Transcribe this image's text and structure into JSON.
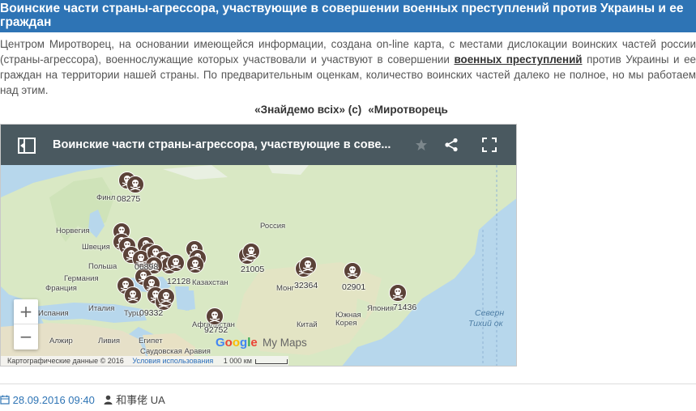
{
  "article": {
    "title": "Воинские части страны-агрессора, участвующие в совершении военных преступлений против Украины и ее граждан",
    "intro_before_link": "Центром Миротворец, на основании имеющейся информации, создана on-line карта, с местами дислокации воинских частей россии (страны-агрессора), военнослужащие которых участвовали и участвуют в совершении ",
    "intro_link": "военных преступлений",
    "intro_after_link": " против Украины и ее граждан на территории нашей страны. По предварительным оценкам,  количество воинских частей далеко не полное, но мы работаем над этим.",
    "slogan_part1": "«Знайдемо всіх» (с)",
    "slogan_part2": "«Миротворець"
  },
  "map": {
    "header_title": "Воинские части страны-агрессора, участвующие в сове...",
    "icons": {
      "sidebar": "sidebar-toggle-icon",
      "star": "star-icon",
      "share": "share-icon",
      "fullscreen": "fullscreen-icon"
    },
    "marker_labels": [
      "08275",
      "06898",
      "12128",
      "21005",
      "32364",
      "02901",
      "71436",
      "09332",
      "92752"
    ],
    "place_labels": {
      "finland": "Финл",
      "norway": "Норвегия",
      "sweden": "Швеция",
      "poland": "Польша",
      "germany": "Германия",
      "france": "Франция",
      "spain": "Испания",
      "italy": "Италия",
      "turkey": "Турц",
      "algeria": "Алжир",
      "libya": "Ливия",
      "egypt": "Египет",
      "saudi": "Саудовская Аравия",
      "russia": "Россия",
      "kazakhstan": "Казахстан",
      "mongolia": "Монг",
      "china": "Китай",
      "afghanistan": "Афганистан",
      "s_korea": "Южная Корея",
      "japan": "Япония",
      "n_pacific": "Северн",
      "pacific": "Тихий ок"
    },
    "zoom_in": "+",
    "zoom_out": "−",
    "google_logo": "Google",
    "mymaps": "My Maps",
    "attribution": "Картографические данные © 2016",
    "terms": "Условия использования",
    "scale": "1 000 км",
    "colors": {
      "header_bg": "#4a5960",
      "marker_fill": "#5b4238",
      "land": "#d9e8c4",
      "water": "#b7d7ec"
    }
  },
  "meta": {
    "date": "28.09.2016 09:40",
    "author": "和事佬 UA"
  },
  "colors": {
    "title_bar": "#2e74b5"
  }
}
